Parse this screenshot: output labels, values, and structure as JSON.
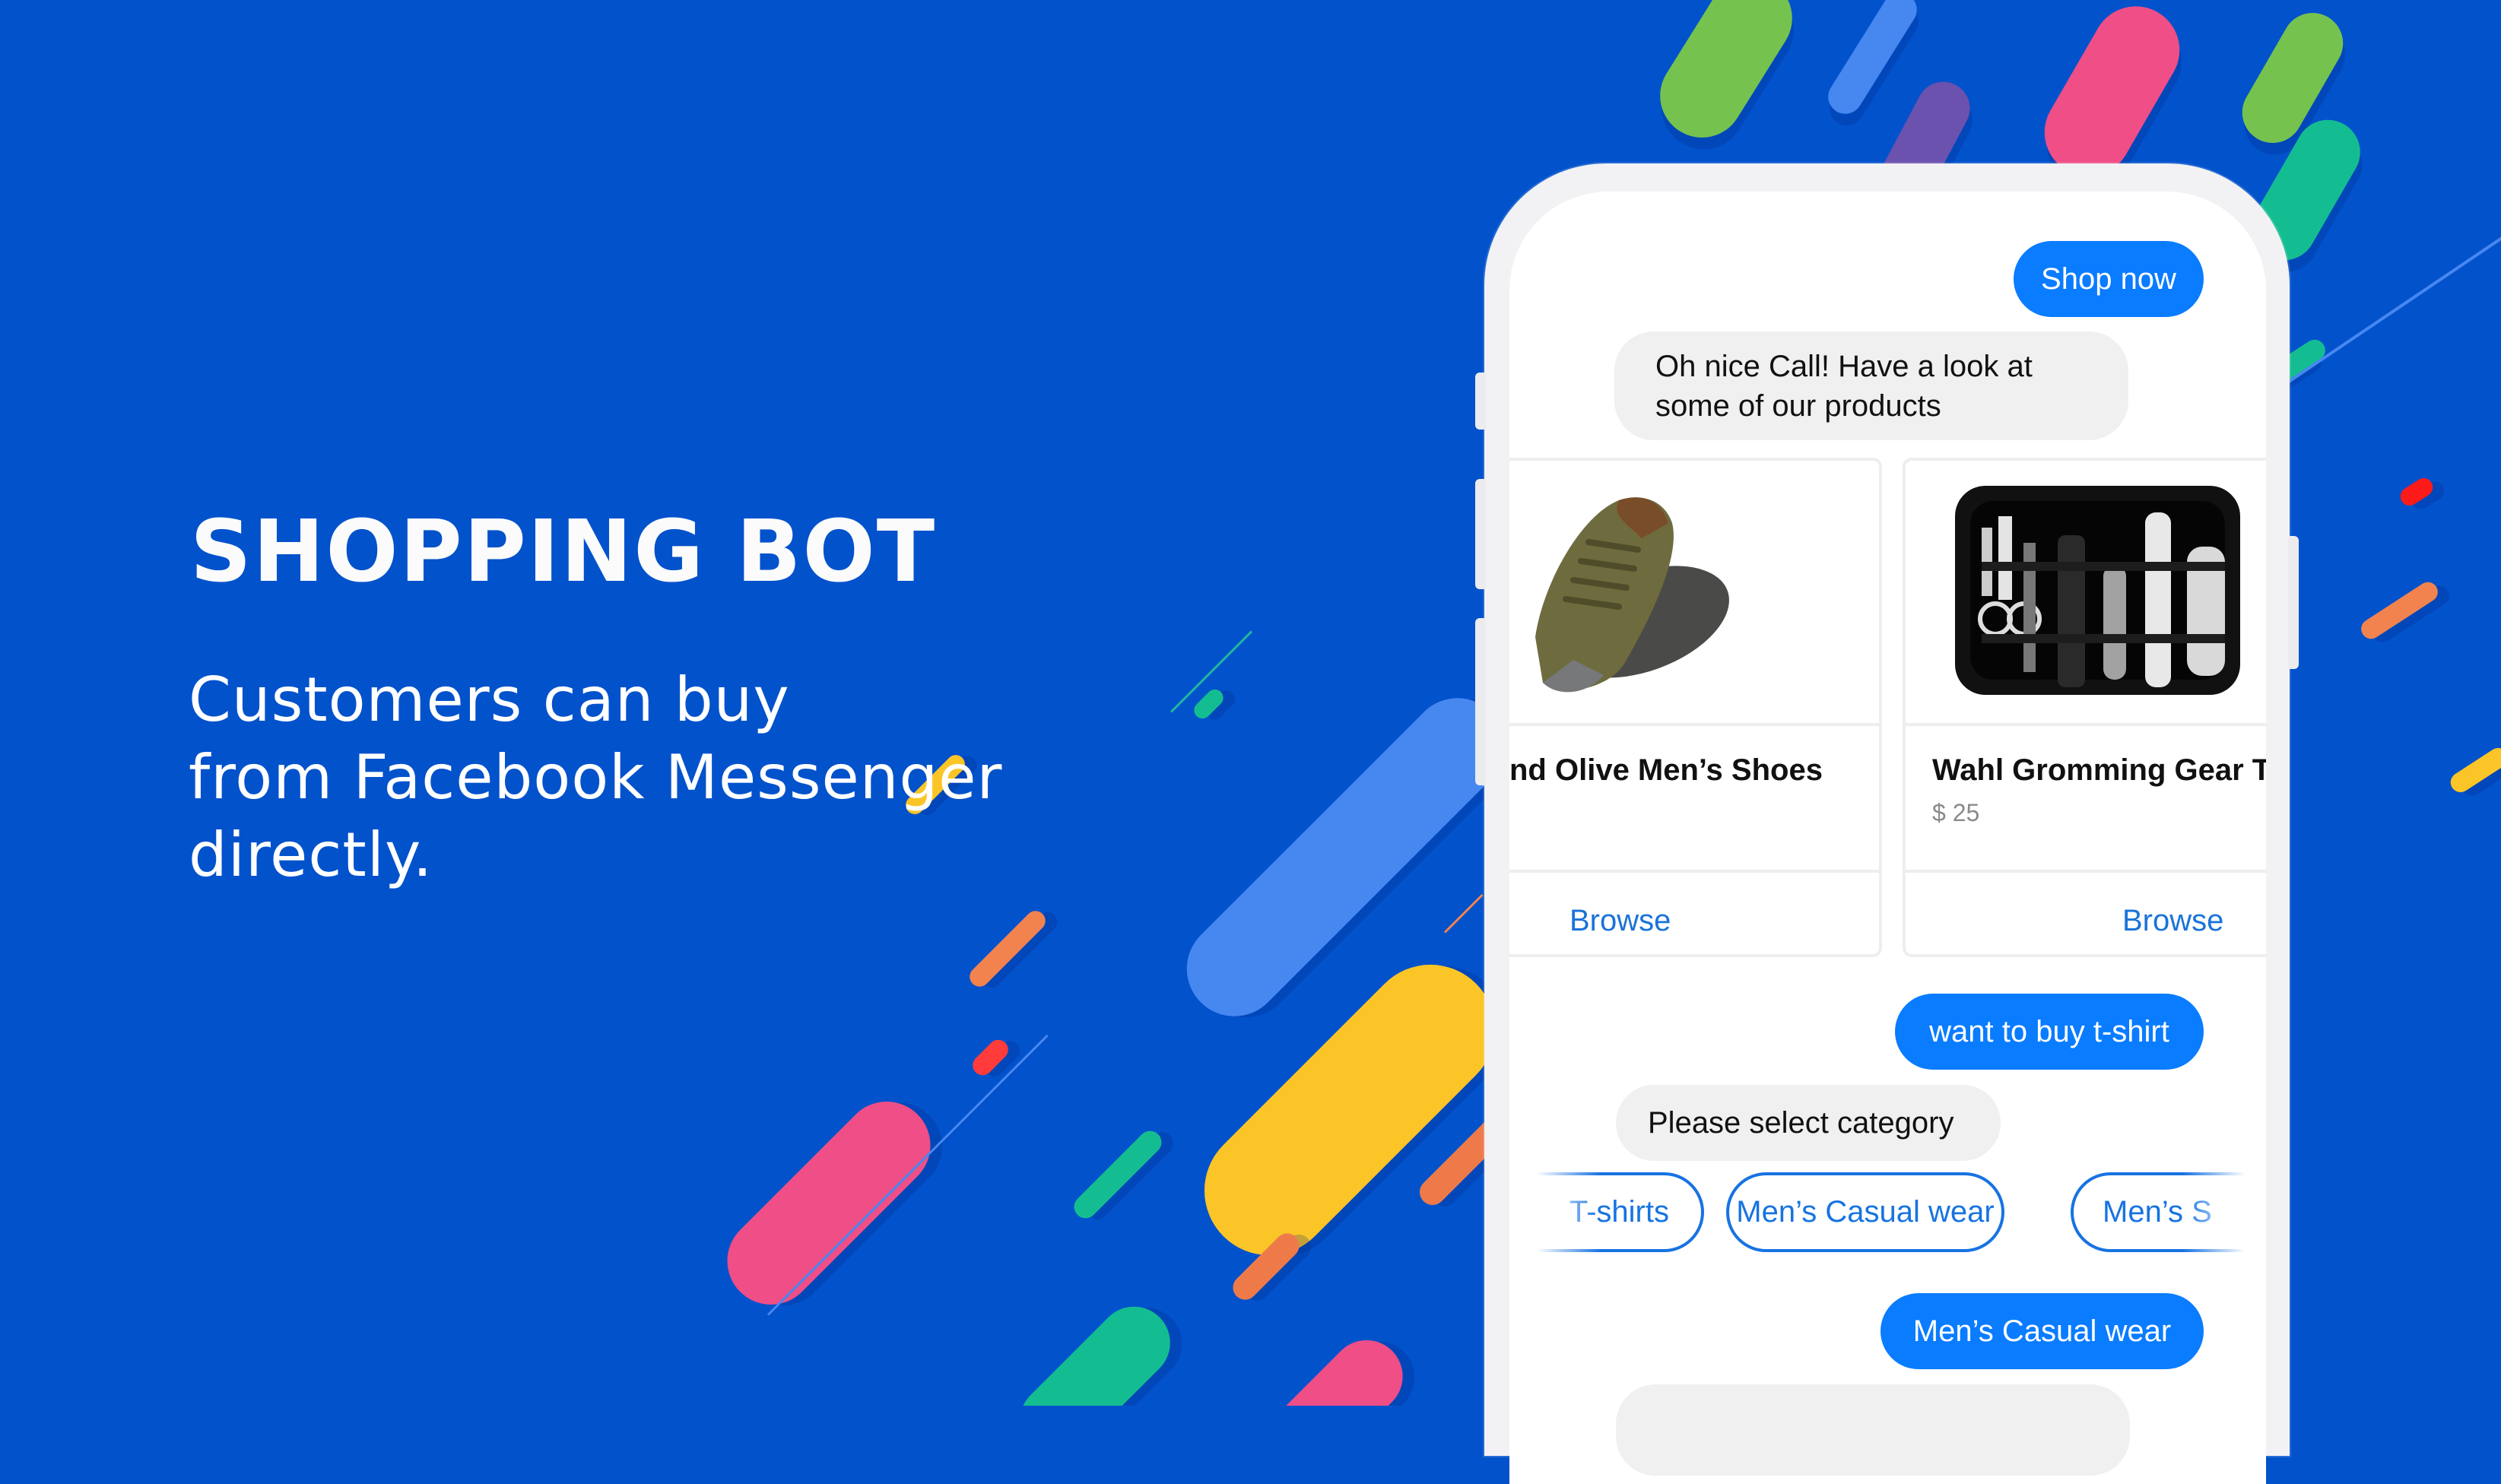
{
  "hero": {
    "title": "SHOPPING BOT",
    "subtitle_lines": [
      "Customers can buy",
      "from Facebook Messenger",
      "directly."
    ]
  },
  "chat": {
    "messages": [
      {
        "from": "user",
        "text": "Shop now"
      },
      {
        "from": "bot",
        "lines": [
          "Oh nice Call! Have a look at",
          "some of our products"
        ]
      },
      {
        "from": "user",
        "text": "want to buy t-shirt"
      },
      {
        "from": "bot",
        "text": "Please select category"
      },
      {
        "from": "user",
        "text": "Men’s Casual wear"
      }
    ],
    "products": [
      {
        "title": "nd Olive Men’s Shoes",
        "price": "",
        "image": "olive-shoes-image",
        "button": "Browse"
      },
      {
        "title": "Wahl Gromming Gear T",
        "price": "$ 25",
        "image": "grooming-kit-image",
        "button": "Browse"
      }
    ],
    "quick_replies": [
      "T-shirts",
      "Men’s Casual wear",
      "Men’s S"
    ]
  },
  "colors": {
    "background": "#0252cc",
    "user_bubble": "#0a7cff",
    "bot_bubble": "#f0f0f1",
    "link": "#1a73d9",
    "quick_reply": "#1773e2"
  }
}
